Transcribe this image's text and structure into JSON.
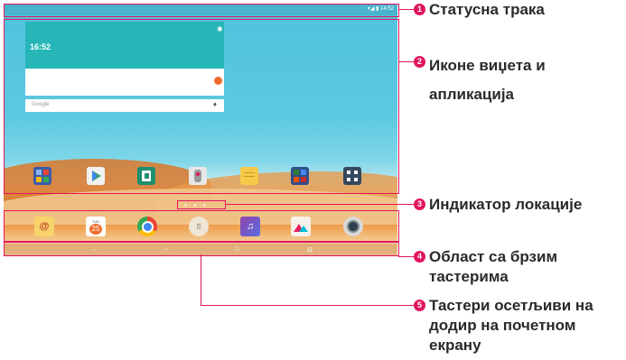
{
  "screen": {
    "status_bar": {
      "icons_text": "▾◢ ▮ 14:52"
    },
    "clock_widget": {
      "time": "16:52"
    },
    "search_widget": {
      "placeholder": "Google"
    },
    "home_row_icons": [
      "folder-icon",
      "play-store-icon",
      "transfer-icon",
      "remote-icon",
      "memo-icon",
      "office-icon",
      "settings-folder-icon"
    ],
    "page_indicator": "● ● ●",
    "dock_icons": [
      "email-icon",
      "calendar-icon",
      "chrome-icon",
      "apps-icon",
      "music-icon",
      "gallery-icon",
      "camera-icon"
    ],
    "calendar_day": "TUE",
    "calendar_date": "25",
    "nav_buttons": {
      "back": "←",
      "home": "○",
      "recent": "□",
      "dual": "⊟"
    }
  },
  "callouts": [
    {
      "number": "1",
      "text": "Статусна трака"
    },
    {
      "number": "2",
      "text": "Иконе виџета и апликација"
    },
    {
      "number": "3",
      "text": "Индикатор локације"
    },
    {
      "number": "4",
      "text": "Област са брзим тастерима"
    },
    {
      "number": "5",
      "text": "Тастери осетљиви на додир на почетном екрану"
    }
  ],
  "colors": {
    "accent": "#e2155f",
    "sky": "#4fc3dd",
    "widget": "#27b6b8"
  }
}
